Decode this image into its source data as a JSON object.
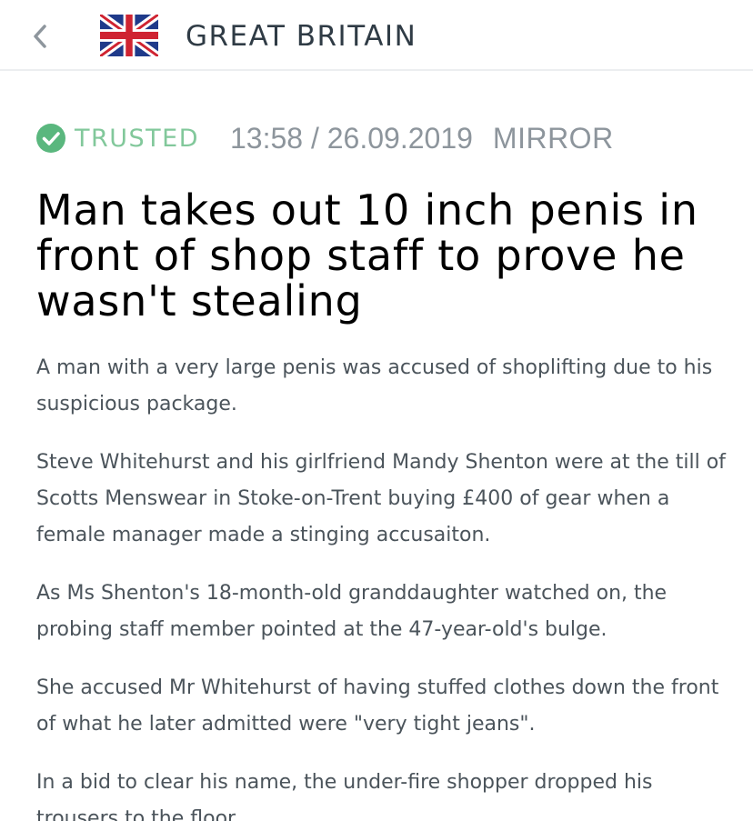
{
  "header": {
    "back_icon": "chevron-left-icon",
    "flag_icon": "uk-flag-icon",
    "country": "GREAT BRITAIN"
  },
  "article": {
    "trust_icon": "check-circle-icon",
    "trust_label": "TRUSTED",
    "timestamp": "13:58 / 26.09.2019",
    "source": "MIRROR",
    "headline": "Man takes out 10 inch penis in front of shop staff to prove he wasn't stealing",
    "paragraphs": [
      "A man with a very large penis was accused of shoplifting due to his suspicious package.",
      "Steve Whitehurst and his girlfriend Mandy Shenton were at the till of Scotts Menswear in Stoke-on-Trent buying £400 of gear when a female manager made a stinging accusaiton.",
      "As Ms Shenton's 18-month-old granddaughter watched on, the probing staff member pointed at the 47-year-old's bulge.",
      "She accused Mr Whitehurst of having stuffed clothes down the front of what he later admitted were \"very tight jeans\".",
      "In a bid to clear his name, the under-fire shopper dropped his trousers to the floor."
    ]
  },
  "colors": {
    "trusted_green": "#82c89b",
    "meta_gray": "#8d959c",
    "body_text": "#4b545b",
    "flag_blue": "#1f3a8a",
    "flag_red": "#cf2331"
  }
}
